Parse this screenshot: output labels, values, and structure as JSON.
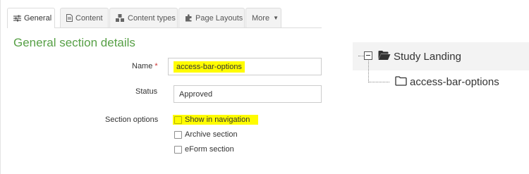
{
  "tabs": [
    {
      "label": "General",
      "icon": "sliders-icon",
      "active": true
    },
    {
      "label": "Content",
      "icon": "document-icon",
      "active": false
    },
    {
      "label": "Content types",
      "icon": "cubes-icon",
      "active": false
    },
    {
      "label": "Page Layouts",
      "icon": "puzzle-icon",
      "active": false
    },
    {
      "label": "More",
      "icon": "caret-down-icon",
      "active": false
    }
  ],
  "section_title": "General section details",
  "fields": {
    "name": {
      "label": "Name",
      "required_mark": "*",
      "value": "access-bar-options"
    },
    "status": {
      "label": "Status",
      "value": "Approved"
    }
  },
  "section_options": {
    "label": "Section options",
    "items": [
      {
        "label": "Show in navigation",
        "checked": false,
        "highlighted": true
      },
      {
        "label": "Archive section",
        "checked": false,
        "highlighted": false
      },
      {
        "label": "eForm section",
        "checked": false,
        "highlighted": false
      }
    ]
  },
  "tree": {
    "root": {
      "label": "Study Landing",
      "icon": "folder-open-icon",
      "expanded": true
    },
    "child": {
      "label": "access-bar-options",
      "icon": "folder-icon"
    }
  },
  "colors": {
    "title_green": "#57a046",
    "highlight_yellow": "#fffc00",
    "tree_row_bg": "#f3f3f3"
  }
}
